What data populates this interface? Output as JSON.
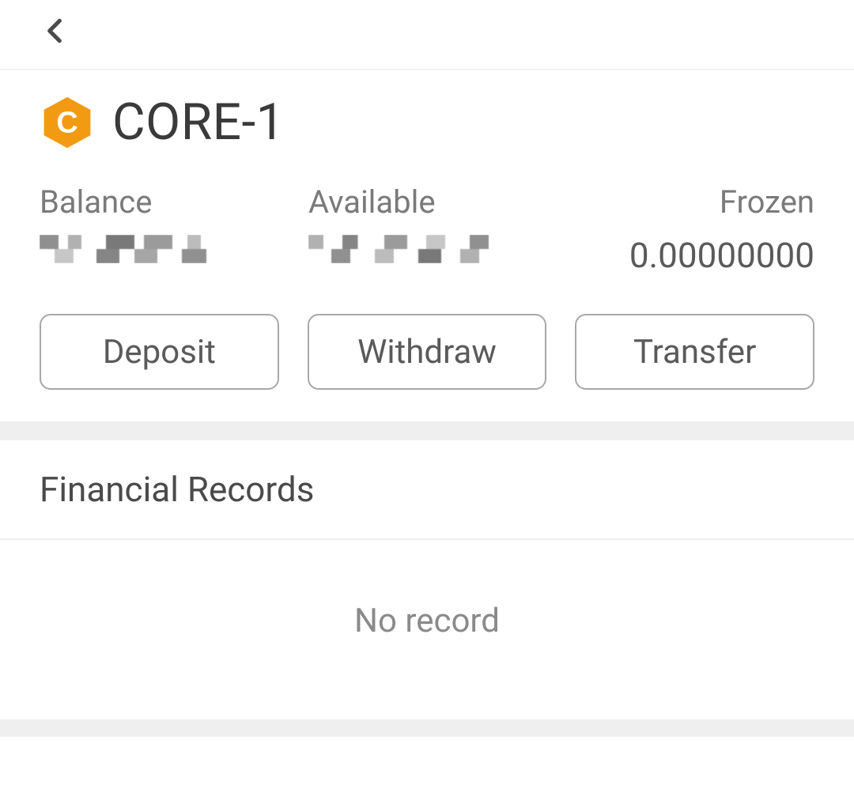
{
  "header": {
    "back_icon": "chevron-left-icon"
  },
  "asset": {
    "icon_letter": "C",
    "icon_bg": "#f39a13",
    "name": "CORE-1",
    "balance_label": "Balance",
    "balance_value": "",
    "available_label": "Available",
    "available_value": "",
    "frozen_label": "Frozen",
    "frozen_value": "0.00000000"
  },
  "actions": {
    "deposit": "Deposit",
    "withdraw": "Withdraw",
    "transfer": "Transfer"
  },
  "records": {
    "title": "Financial Records",
    "empty_text": "No record"
  }
}
